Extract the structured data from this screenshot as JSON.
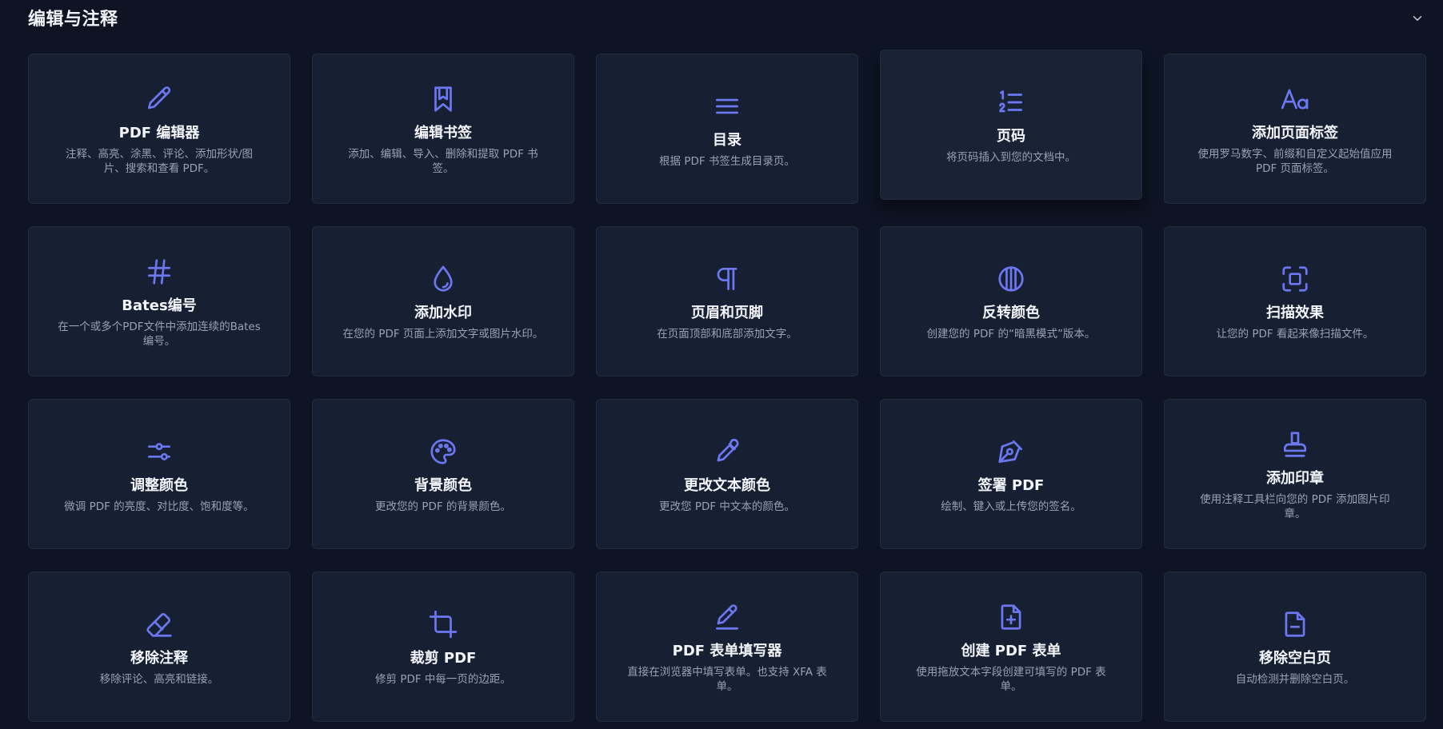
{
  "section": {
    "title": "编辑与注释",
    "toggle_icon": "chevron-down-icon"
  },
  "colors": {
    "background": "#0e1424",
    "card": "#172033",
    "accent": "#6b78f2"
  },
  "tools": [
    {
      "title": "PDF 编辑器",
      "desc": "注释、高亮、涂黑、评论、添加形状/图片、搜索和查看 PDF。",
      "icon": "pencil-icon"
    },
    {
      "title": "编辑书签",
      "desc": "添加、编辑、导入、删除和提取 PDF 书签。",
      "icon": "bookmark-icon"
    },
    {
      "title": "目录",
      "desc": "根据 PDF 书签生成目录页。",
      "icon": "list-lines-icon"
    },
    {
      "title": "页码",
      "desc": "将页码插入到您的文档中。",
      "icon": "numbered-list-icon"
    },
    {
      "title": "添加页面标签",
      "desc": "使用罗马数字、前缀和自定义起始值应用 PDF 页面标签。",
      "icon": "text-aa-icon"
    },
    {
      "title": "Bates编号",
      "desc": "在一个或多个PDF文件中添加连续的Bates编号。",
      "icon": "hash-icon"
    },
    {
      "title": "添加水印",
      "desc": "在您的 PDF 页面上添加文字或图片水印。",
      "icon": "droplet-icon"
    },
    {
      "title": "页眉和页脚",
      "desc": "在页面顶部和底部添加文字。",
      "icon": "pilcrow-icon"
    },
    {
      "title": "反转颜色",
      "desc": "创建您的 PDF 的“暗黑模式”版本。",
      "icon": "contrast-icon"
    },
    {
      "title": "扫描效果",
      "desc": "让您的 PDF 看起来像扫描文件。",
      "icon": "scan-frame-icon"
    },
    {
      "title": "调整颜色",
      "desc": "微调 PDF 的亮度、对比度、饱和度等。",
      "icon": "sliders-icon"
    },
    {
      "title": "背景颜色",
      "desc": "更改您的 PDF 的背景颜色。",
      "icon": "palette-icon"
    },
    {
      "title": "更改文本颜色",
      "desc": "更改您 PDF 中文本的颜色。",
      "icon": "eyedropper-icon"
    },
    {
      "title": "签署 PDF",
      "desc": "绘制、键入或上传您的签名。",
      "icon": "pen-nib-icon"
    },
    {
      "title": "添加印章",
      "desc": "使用注释工具栏向您的 PDF 添加图片印章。",
      "icon": "stamp-icon"
    },
    {
      "title": "移除注释",
      "desc": "移除评论、高亮和链接。",
      "icon": "eraser-icon"
    },
    {
      "title": "裁剪 PDF",
      "desc": "修剪 PDF 中每一页的边距。",
      "icon": "crop-icon"
    },
    {
      "title": "PDF 表单填写器",
      "desc": "直接在浏览器中填写表单。也支持 XFA 表单。",
      "icon": "pencil-underline-icon"
    },
    {
      "title": "创建 PDF 表单",
      "desc": "使用拖放文本字段创建可填写的 PDF 表单。",
      "icon": "file-plus-icon"
    },
    {
      "title": "移除空白页",
      "desc": "自动检测并删除空白页。",
      "icon": "file-minus-icon"
    }
  ]
}
